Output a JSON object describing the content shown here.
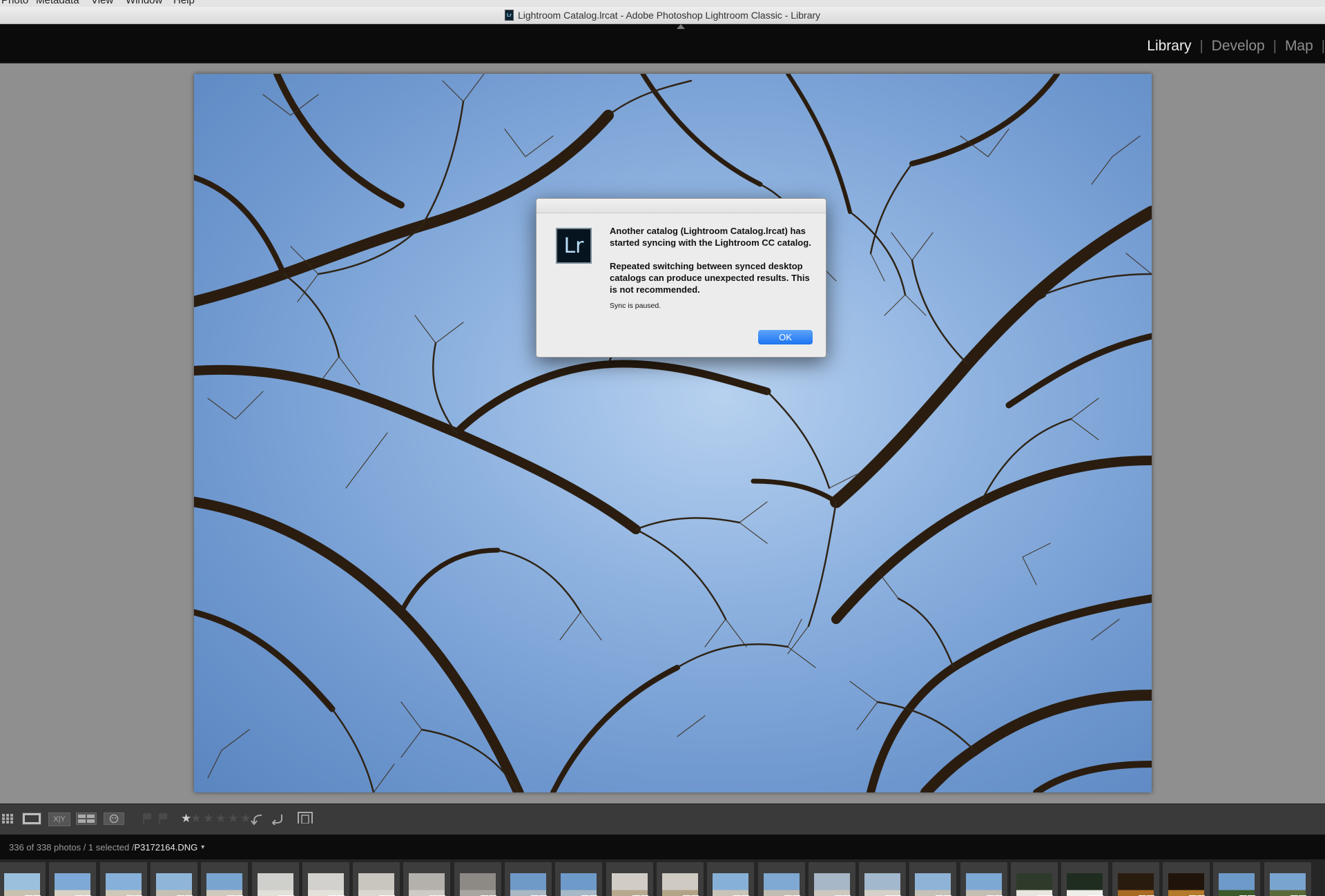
{
  "menubar": {
    "items": [
      "Photo",
      "Metadata",
      "View",
      "Window",
      "Help"
    ]
  },
  "window": {
    "title": "Lightroom Catalog.lrcat - Adobe Photoshop Lightroom Classic - Library",
    "doc_icon": "Lr"
  },
  "modules": {
    "items": [
      {
        "label": "Library",
        "active": true
      },
      {
        "label": "Develop",
        "active": false
      },
      {
        "label": "Map",
        "active": false
      }
    ],
    "separator": "|"
  },
  "dialog": {
    "icon_label": "Lr",
    "message_primary": "Another catalog (Lightroom Catalog.lrcat) has started syncing with the Lightroom CC catalog.",
    "message_secondary": "Repeated switching between synced desktop catalogs can produce unexpected results. This is not recommended.",
    "message_small": "Sync is paused.",
    "ok_label": "OK"
  },
  "toolbar": {
    "icons": [
      "grid-view-icon",
      "loupe-view-icon",
      "compare-view-icon",
      "survey-view-icon",
      "people-view-icon",
      "flag-pick-icon",
      "flag-reject-icon",
      "star-rating-icon",
      "rotate-left-icon",
      "rotate-right-icon",
      "crop-overlay-icon"
    ],
    "compare_label": "X|Y",
    "stars": "★ ★ ★ ★ ★"
  },
  "status": {
    "count": "336 of 338 photos / 1 selected /",
    "filename": "P3172164.DNG",
    "caret": "▾"
  },
  "colors": {
    "accent_blue": "#1d74f0",
    "module_bar": "#0b0b0b",
    "background": "#8f8f8f"
  }
}
